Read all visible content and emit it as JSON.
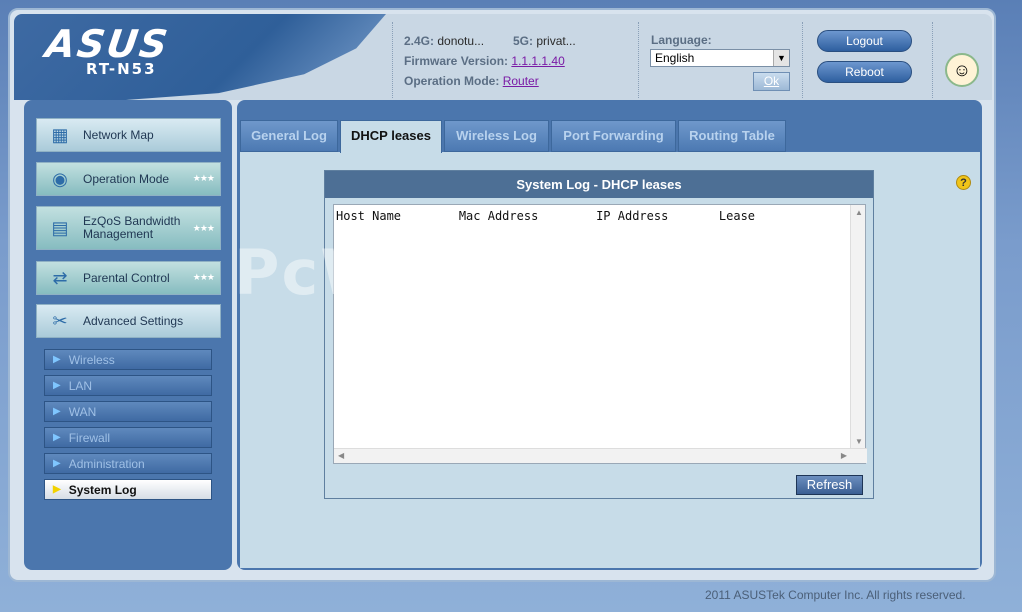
{
  "header": {
    "logo": "ASUS",
    "model": "RT-N53",
    "band24_label": "2.4G:",
    "band24_value": "donotu...",
    "band5_label": "5G:",
    "band5_value": "privat...",
    "firmware_label": "Firmware Version:",
    "firmware_value": "1.1.1.1.40",
    "opmode_label": "Operation Mode:",
    "opmode_value": "Router",
    "language_label": "Language:",
    "language_value": "English",
    "ok_label": "Ok",
    "logout_label": "Logout",
    "reboot_label": "Reboot",
    "avatar_icon": "avatar-icon"
  },
  "sidebar": {
    "items": [
      {
        "label": "Network Map",
        "icon": "network-map-icon"
      },
      {
        "label": "Operation Mode",
        "icon": "router-icon"
      },
      {
        "label": "EzQoS Bandwidth Management",
        "icon": "qos-icon"
      },
      {
        "label": "Parental Control",
        "icon": "parental-icon"
      },
      {
        "label": "Advanced Settings",
        "icon": "tools-icon"
      }
    ],
    "subitems": [
      {
        "label": "Wireless"
      },
      {
        "label": "LAN"
      },
      {
        "label": "WAN"
      },
      {
        "label": "Firewall"
      },
      {
        "label": "Administration"
      },
      {
        "label": "System Log"
      }
    ]
  },
  "tabs": [
    {
      "label": "General Log"
    },
    {
      "label": "DHCP leases"
    },
    {
      "label": "Wireless Log"
    },
    {
      "label": "Port Forwarding"
    },
    {
      "label": "Routing Table"
    }
  ],
  "log": {
    "title": "System Log - DHCP leases",
    "columns": [
      "Host Name",
      "Mac Address",
      "IP Address",
      "Lease"
    ],
    "header_line": "Host Name        Mac Address        IP Address       Lease",
    "refresh_label": "Refresh"
  },
  "watermark": "PcWinTech.com",
  "footer": "2011 ASUSTek Computer Inc. All rights reserved."
}
